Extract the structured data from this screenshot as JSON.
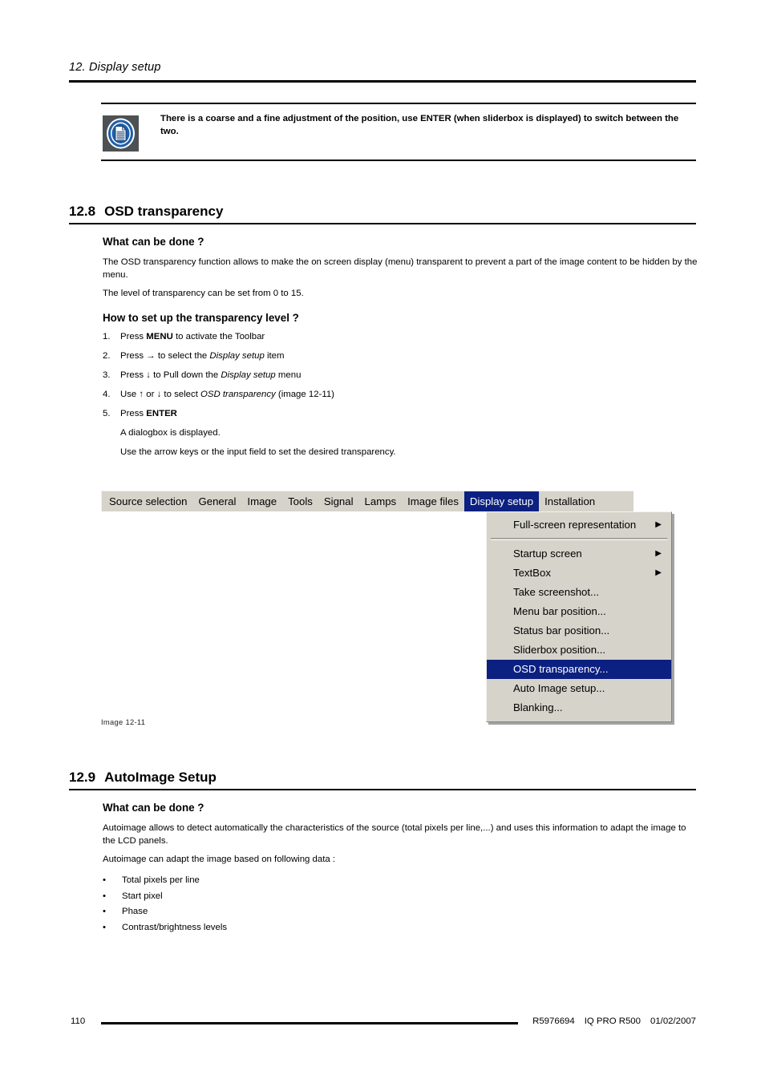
{
  "header": {
    "chapter": "12.  Display setup"
  },
  "note": {
    "icon": "document-note-icon",
    "text": "There is a coarse and a fine adjustment of the position, use ENTER (when sliderbox is displayed) to switch between the two."
  },
  "section_12_8": {
    "number": "12.8",
    "title": "OSD transparency",
    "sub_what": "What can be done ?",
    "para1": "The OSD transparency function allows to make the on screen display (menu) transparent to prevent a part of the image content to be hidden by the menu.",
    "para2": "The level of transparency can be set from 0 to 15.",
    "sub_how": "How to set up the transparency level ?",
    "steps": [
      {
        "index": "1.",
        "html": "Press <b class=\"st\">MENU</b> to activate the Toolbar"
      },
      {
        "index": "2.",
        "html": "Press → to select the <i class=\"em\">Display setup</i> item"
      },
      {
        "index": "3.",
        "html": "Press ↓ to Pull down the <i class=\"em\">Display setup</i> menu"
      },
      {
        "index": "4.",
        "html": "Use ↑ or ↓ to select <i class=\"em\">OSD transparency</i> (image 12-11)"
      },
      {
        "index": "5.",
        "html": "Press <b class=\"st\">ENTER</b>"
      }
    ],
    "step_notes": [
      "A dialogbox is displayed.",
      "Use the arrow keys or the input field to set the desired transparency."
    ]
  },
  "figure": {
    "caption": "Image 12-11",
    "menubar": [
      {
        "label": "Source selection",
        "active": false
      },
      {
        "label": "General",
        "active": false
      },
      {
        "label": "Image",
        "active": false
      },
      {
        "label": "Tools",
        "active": false
      },
      {
        "label": "Signal",
        "active": false
      },
      {
        "label": "Lamps",
        "active": false
      },
      {
        "label": "Image files",
        "active": false
      },
      {
        "label": "Display setup",
        "active": true
      },
      {
        "label": "Installation",
        "active": false
      }
    ],
    "dropdown": [
      {
        "label": "Full-screen representation",
        "submenu": true,
        "selected": false,
        "separator_after": true
      },
      {
        "label": "Startup screen",
        "submenu": true,
        "selected": false,
        "separator_after": false
      },
      {
        "label": "TextBox",
        "submenu": true,
        "selected": false,
        "separator_after": false
      },
      {
        "label": "Take screenshot...",
        "submenu": false,
        "selected": false,
        "separator_after": false
      },
      {
        "label": "Menu bar position...",
        "submenu": false,
        "selected": false,
        "separator_after": false
      },
      {
        "label": "Status bar position...",
        "submenu": false,
        "selected": false,
        "separator_after": false
      },
      {
        "label": "Sliderbox position...",
        "submenu": false,
        "selected": false,
        "separator_after": false
      },
      {
        "label": "OSD transparency...",
        "submenu": false,
        "selected": true,
        "separator_after": false
      },
      {
        "label": "Auto Image setup...",
        "submenu": false,
        "selected": false,
        "separator_after": false
      },
      {
        "label": "Blanking...",
        "submenu": false,
        "selected": false,
        "separator_after": false
      }
    ],
    "submenu_arrow": "▶",
    "colors": {
      "menu_face": "#d6d3cb",
      "highlight": "#0b2080",
      "highlight_text": "#ffffff"
    }
  },
  "section_12_9": {
    "number": "12.9",
    "title": "AutoImage Setup",
    "sub_what": "What can be done ?",
    "para1": "Autoimage allows to detect automatically the characteristics of the source (total pixels per line,...) and uses this information to adapt the image to the LCD panels.",
    "para2": "Autoimage can adapt the image based on following data :",
    "bullet_marker": "•",
    "bullets": [
      "Total pixels per line",
      "Start pixel",
      "Phase",
      "Contrast/brightness levels"
    ]
  },
  "footer": {
    "page_number": "110",
    "doc_code": "R5976694",
    "product": "IQ PRO R500",
    "date": "01/02/2007"
  }
}
